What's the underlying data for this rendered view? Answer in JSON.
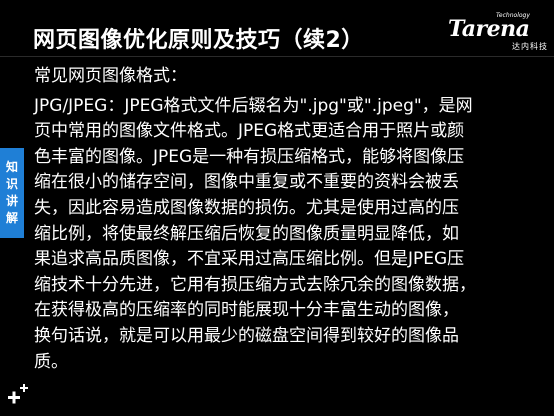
{
  "title": "网页图像优化原则及技巧（续2）",
  "logo": {
    "tagline": "Technology",
    "wordmark": "Tarena",
    "chinese": "达内科技"
  },
  "side_tab": {
    "chars": [
      "知",
      "识",
      "讲",
      "解"
    ]
  },
  "content": {
    "subheading": "常见网页图像格式：",
    "lines": [
      "JPG/JPEG：JPEG格式文件后辍名为\".jpg\"或\".jpeg\"，是网",
      "页中常用的图像文件格式。JPEG格式更适合用于照片或颜",
      "色丰富的图像。JPEG是一种有损压缩格式，能够将图像压",
      "缩在很小的储存空间，图像中重复或不重要的资料会被丢",
      "失，因此容易造成图像数据的损伤。尤其是使用过高的压",
      "缩比例，将使最终解压缩后恢复的图像质量明显降低，如",
      "果追求高品质图像，不宜采用过高压缩比例。但是JPEG压",
      "缩技术十分先进，它用有损压缩方式去除冗余的图像数据，",
      "在获得极高的压缩率的同时能展现十分丰富生动的图像，",
      "换句话说，就是可以用最少的磁盘空间得到较好的图像品",
      "质。"
    ]
  },
  "colors": {
    "background": "#000000",
    "text": "#ffffff",
    "accent": "#1f7fd6"
  },
  "icons": {
    "bottom_left": "plus-decoration-icon"
  }
}
